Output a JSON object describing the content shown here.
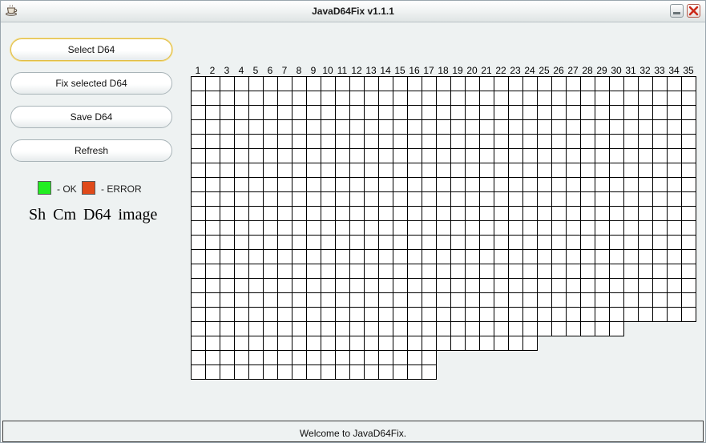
{
  "window": {
    "title": "JavaD64Fix v1.1.1"
  },
  "icons": {
    "app": "teacup-icon",
    "minimize": "minimize-icon",
    "close": "close-icon"
  },
  "buttons": {
    "select": "Select D64",
    "fix": "Fix selected D64",
    "save": "Save D64",
    "refresh": "Refresh"
  },
  "legend": {
    "ok_label": "- OK",
    "error_label": "- ERROR",
    "ok_color": "#22ee22",
    "error_color": "#e04a1a"
  },
  "image_name": "Sh Cm D64 image",
  "tracks": {
    "labels": [
      "1",
      "2",
      "3",
      "4",
      "5",
      "6",
      "7",
      "8",
      "9",
      "10",
      "11",
      "12",
      "13",
      "14",
      "15",
      "16",
      "17",
      "18",
      "19",
      "20",
      "21",
      "22",
      "23",
      "24",
      "25",
      "26",
      "27",
      "28",
      "29",
      "30",
      "31",
      "32",
      "33",
      "34",
      "35"
    ],
    "sectors_per_track": [
      21,
      21,
      21,
      21,
      21,
      21,
      21,
      21,
      21,
      21,
      21,
      21,
      21,
      21,
      21,
      21,
      21,
      19,
      19,
      19,
      19,
      19,
      19,
      19,
      18,
      18,
      18,
      18,
      18,
      18,
      17,
      17,
      17,
      17,
      17
    ]
  },
  "status": {
    "message": "Welcome to JavaD64Fix."
  }
}
